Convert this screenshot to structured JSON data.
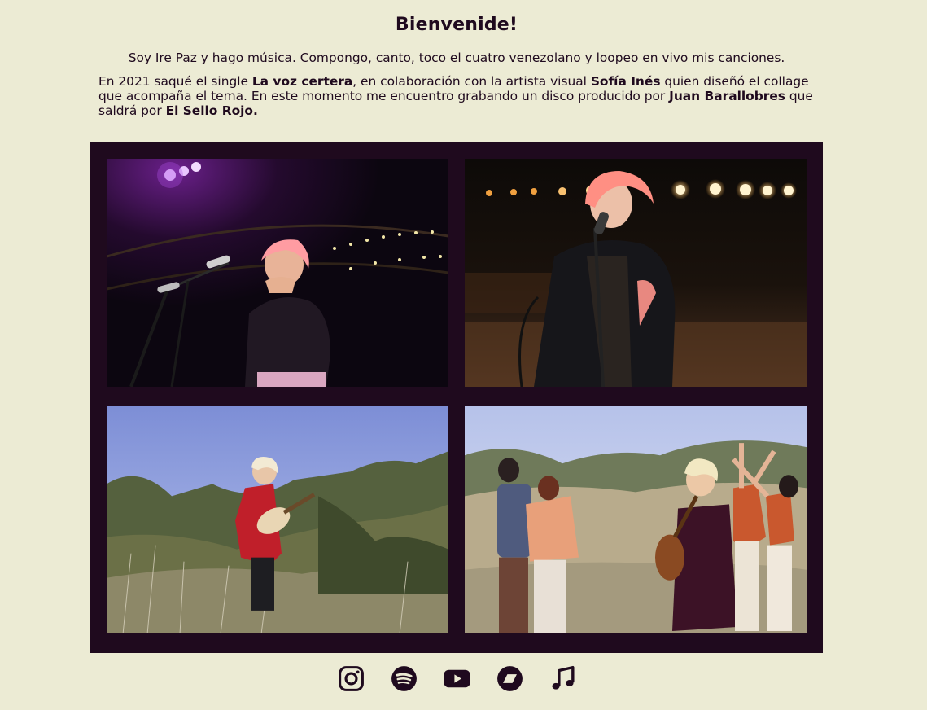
{
  "header": {
    "title": "Bienvenide!"
  },
  "intro": "Soy Ire Paz y hago música. Compongo, canto, toco el cuatro venezolano y loopeo en vivo mis canciones.",
  "bio": {
    "part1": "En 2021 saqué el single ",
    "single": "La voz certera",
    "part2": ", en colaboración con la artista visual ",
    "artist": "Sofía Inés",
    "part3": " quien diseñó el collage que acompaña el tema. En este momento me encuentro grabando un disco producido por ",
    "producer": "Juan Barallobres",
    "part4": " que saldrá por ",
    "label": "El Sello Rojo."
  },
  "gallery": {
    "background": "#1f0a1e",
    "photos": [
      {
        "scene": "stage-concert-purple-lights"
      },
      {
        "scene": "stage-concert-warm-lights"
      },
      {
        "scene": "field-guitar-red-jacket"
      },
      {
        "scene": "field-guitar-with-dancers"
      }
    ]
  },
  "social": [
    {
      "icon": "instagram-icon"
    },
    {
      "icon": "spotify-icon"
    },
    {
      "icon": "youtube-icon"
    },
    {
      "icon": "bandcamp-icon"
    },
    {
      "icon": "music-note-icon"
    }
  ],
  "colors": {
    "background": "#ecebd4",
    "text": "#1f0a1e",
    "accent": "#1f0a1e"
  }
}
